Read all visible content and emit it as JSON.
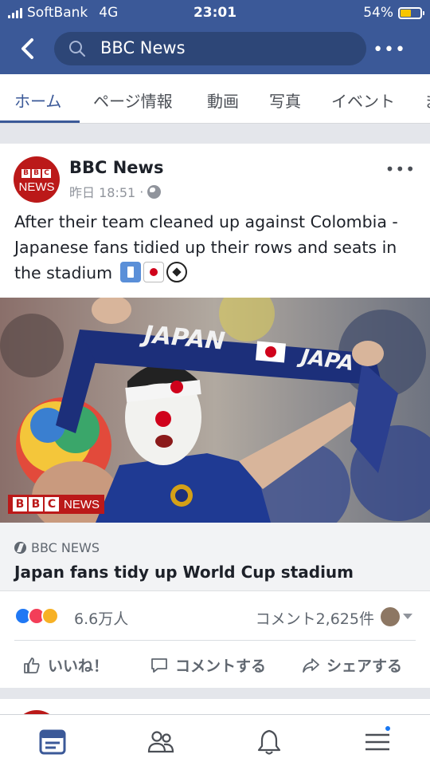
{
  "status_bar": {
    "carrier": "SoftBank",
    "network": "4G",
    "time": "23:01",
    "battery_percent": "54%",
    "battery_level": 0.54
  },
  "header": {
    "search_text": "BBC News",
    "more_label": "•••"
  },
  "tabs": [
    {
      "label": "ホーム",
      "active": true
    },
    {
      "label": "ページ情報",
      "active": false
    },
    {
      "label": "動画",
      "active": false
    },
    {
      "label": "写真",
      "active": false
    },
    {
      "label": "イベント",
      "active": false
    },
    {
      "label": "ま",
      "active": false
    }
  ],
  "post": {
    "page_name": "BBC News",
    "avatar_blocks": [
      "B",
      "B",
      "C"
    ],
    "avatar_word": "NEWS",
    "timestamp": "昨日 18:51",
    "separator": "·",
    "more_label": "•••",
    "text": "After their team cleaned up against Colombia - Japanese fans tidied up their rows and seats in the stadium",
    "image": {
      "scarf_text": "JAPAN",
      "scarf_text_2": "JAPA",
      "logo_blocks": [
        "B",
        "B",
        "C"
      ],
      "logo_word": "NEWS"
    },
    "link": {
      "source": "BBC NEWS",
      "title": "Japan fans tidy up World Cup stadium"
    },
    "reactions": {
      "count": "6.6万人",
      "comments": "コメント2,625件"
    },
    "actions": {
      "like": "いいね！",
      "comment": "コメントする",
      "share": "シェアする"
    }
  },
  "colors": {
    "header_blue": "#3b5998",
    "bbc_red": "#bb1919",
    "like_blue": "#2078f4"
  },
  "icons": [
    "back-chevron-icon",
    "search-icon",
    "globe-icon",
    "trash-emoji-icon",
    "japan-flag-emoji-icon",
    "soccer-ball-emoji-icon",
    "like-icon",
    "comment-icon",
    "share-icon",
    "news-feed-icon",
    "friends-icon",
    "notifications-icon",
    "menu-icon"
  ]
}
